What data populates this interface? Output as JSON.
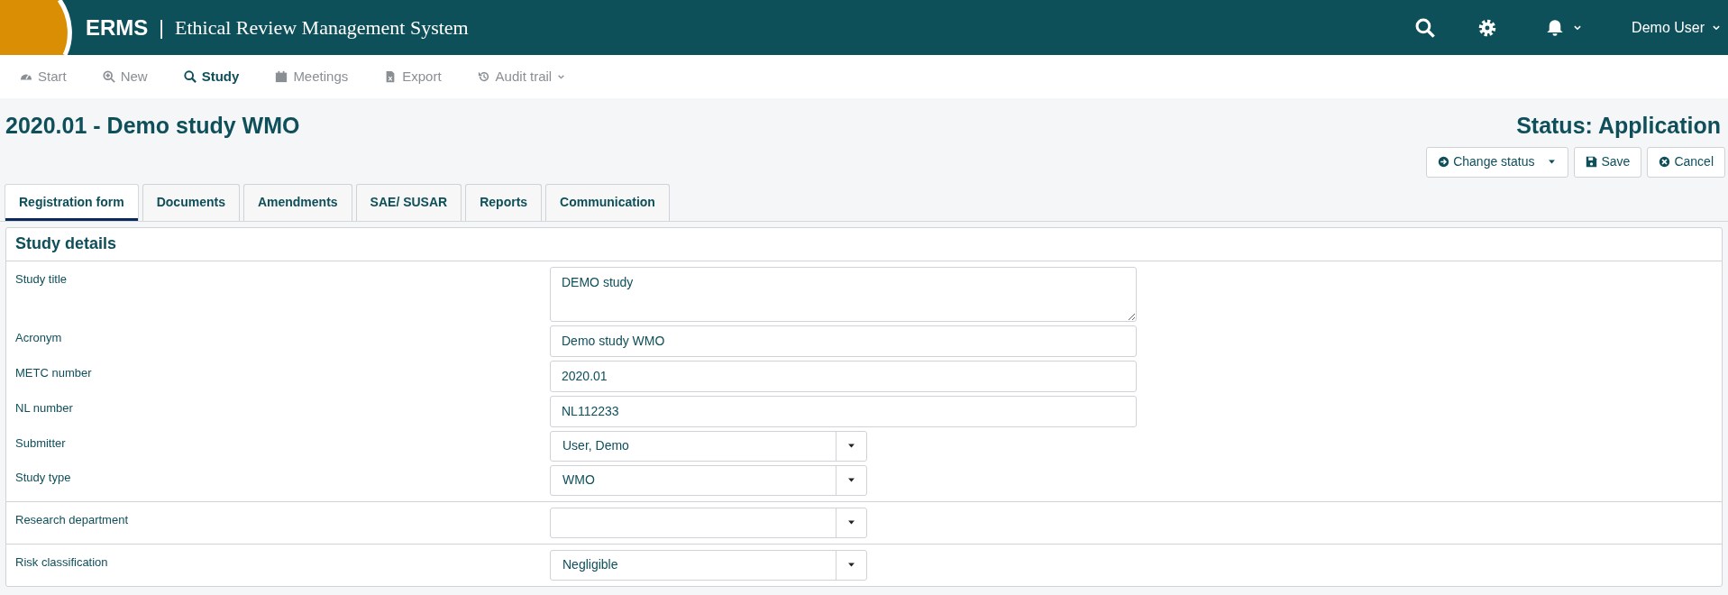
{
  "header": {
    "app_short": "ERMS",
    "separator": "|",
    "app_title": "Ethical Review Management System",
    "user": "Demo User"
  },
  "nav": [
    {
      "label": "Start",
      "selected": false,
      "dropdown": false
    },
    {
      "label": "New",
      "selected": false,
      "dropdown": false
    },
    {
      "label": "Study",
      "selected": true,
      "dropdown": false
    },
    {
      "label": "Meetings",
      "selected": false,
      "dropdown": false
    },
    {
      "label": "Export",
      "selected": false,
      "dropdown": false
    },
    {
      "label": "Audit trail",
      "selected": false,
      "dropdown": true
    }
  ],
  "page": {
    "title": "2020.01 - Demo study WMO",
    "status": "Status: Application"
  },
  "actions": [
    {
      "label": "Change status",
      "dropdown": true
    },
    {
      "label": "Save",
      "dropdown": false
    },
    {
      "label": "Cancel",
      "dropdown": false
    }
  ],
  "tabs": [
    {
      "label": "Registration form",
      "selected": true
    },
    {
      "label": "Documents",
      "selected": false
    },
    {
      "label": "Amendments",
      "selected": false
    },
    {
      "label": "SAE/ SUSAR",
      "selected": false
    },
    {
      "label": "Reports",
      "selected": false
    },
    {
      "label": "Communication",
      "selected": false
    }
  ],
  "panel": {
    "title": "Study details",
    "groups": [
      [
        {
          "label": "Study title",
          "kind": "textarea",
          "value": "DEMO study"
        },
        {
          "label": "Acronym",
          "kind": "text",
          "value": "Demo study WMO"
        },
        {
          "label": "METC number",
          "kind": "text",
          "value": "2020.01"
        },
        {
          "label": "NL number",
          "kind": "text",
          "value": "NL112233"
        },
        {
          "label": "Submitter",
          "kind": "select",
          "value": "User, Demo"
        },
        {
          "label": "Study type",
          "kind": "select",
          "value": "WMO"
        }
      ],
      [
        {
          "label": "Research department",
          "kind": "select"
        }
      ],
      [
        {
          "label": "Risk classification",
          "kind": "select",
          "value": "Negligible"
        }
      ]
    ]
  }
}
